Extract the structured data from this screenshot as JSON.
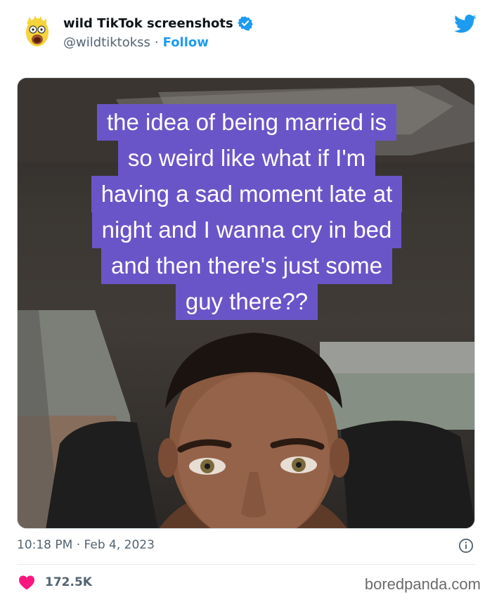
{
  "account": {
    "display_name": "wild TikTok screenshots",
    "handle": "@wildtiktokss",
    "separator": "·",
    "follow_label": "Follow"
  },
  "media": {
    "caption_lines": [
      "the idea of being married is",
      "so weird like what if I'm",
      "having a sad moment late at",
      "night and I wanna cry in bed",
      "and then there's just some",
      "guy there??"
    ]
  },
  "meta": {
    "time": "10:18 PM",
    "separator": "·",
    "date": "Feb 4, 2023"
  },
  "engagement": {
    "likes": "172.5K"
  },
  "watermark": "boredpanda.com",
  "colors": {
    "accent": "#1d9bf0",
    "heart": "#f91880",
    "caption_bg": "#6a55c8"
  },
  "icons": {
    "avatar": "cartoon-avatar",
    "verified": "verified-badge-icon",
    "logo": "twitter-bird-icon",
    "info": "info-icon",
    "like": "heart-icon"
  }
}
